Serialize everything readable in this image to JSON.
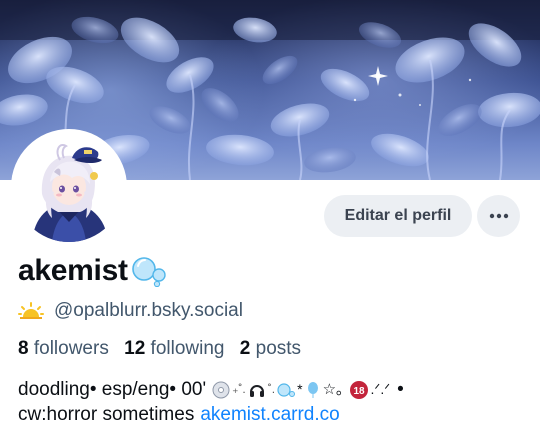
{
  "profile": {
    "display_name": "akemist",
    "handle": "@opalblurr.bsky.social",
    "edit_button_label": "Editar el perfil",
    "stats": {
      "followers_count": "8",
      "followers_label": "followers",
      "following_count": "12",
      "following_label": "following",
      "posts_count": "2",
      "posts_label": "posts"
    },
    "bio": {
      "line1_start": "doodling• esp/eng• 00'",
      "line1_end": "•",
      "line2_text": "cw:horror sometimes",
      "line2_link": "akemist.carrd.co"
    }
  },
  "icons": {
    "more": "ellipsis-icon",
    "name_decoration": "bubbles-icon",
    "handle_decoration": "sun-icon"
  },
  "colors": {
    "link": "#1083fe",
    "muted_text": "#42576c",
    "button_bg": "#eceff3"
  }
}
